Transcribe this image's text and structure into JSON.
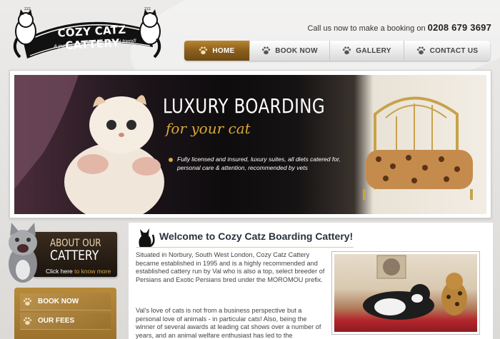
{
  "brand": {
    "name": "COZY CATZ CATTERY",
    "tagline": "A purrfect stay for your special friend!"
  },
  "header": {
    "call_text": "Call us now to make a booking on",
    "phone": "0208 679 3697"
  },
  "nav": {
    "items": [
      {
        "label": "HOME",
        "active": true,
        "icon": "paw-icon"
      },
      {
        "label": "BOOK NOW",
        "active": false,
        "icon": "paw-icon"
      },
      {
        "label": "GALLERY",
        "active": false,
        "icon": "paw-icon"
      },
      {
        "label": "CONTACT US",
        "active": false,
        "icon": "paw-icon"
      }
    ]
  },
  "hero": {
    "title": "LUXURY BOARDING",
    "subtitle": "for your cat",
    "description": "Fully licensed and insured, luxury suites, all diets catered for, personal care & attention, recommended by vets"
  },
  "sidebar": {
    "about_line1": "ABOUT OUR",
    "about_line2": "CATTERY",
    "about_link_prefix": "Click here",
    "about_link_suffix": "to know more",
    "menu": [
      {
        "label": "BOOK NOW",
        "icon": "paw-icon"
      },
      {
        "label": "OUR FEES",
        "icon": "paw-icon"
      }
    ]
  },
  "main": {
    "title": "Welcome to Cozy Catz Boarding Cattery!",
    "paragraph1": "Situated in Norbury, South West London, Cozy Catz Cattery became established in 1995 and is a highly recommended and established cattery run by Val  who is also a top, select breeder of Persians and Exotic Persians bred under the MOROMOU prefix.",
    "paragraph2": "Val's  love of cats is not from a business perspective but a personal love of animals - in particular cats! Also, being the winner of several awards at leading cat shows over a number of years, and an animal welfare enthusiast has led to the"
  },
  "colors": {
    "accent_gold": "#b8862f",
    "accent_dark": "#1b140e",
    "title_text": "#27333d"
  }
}
